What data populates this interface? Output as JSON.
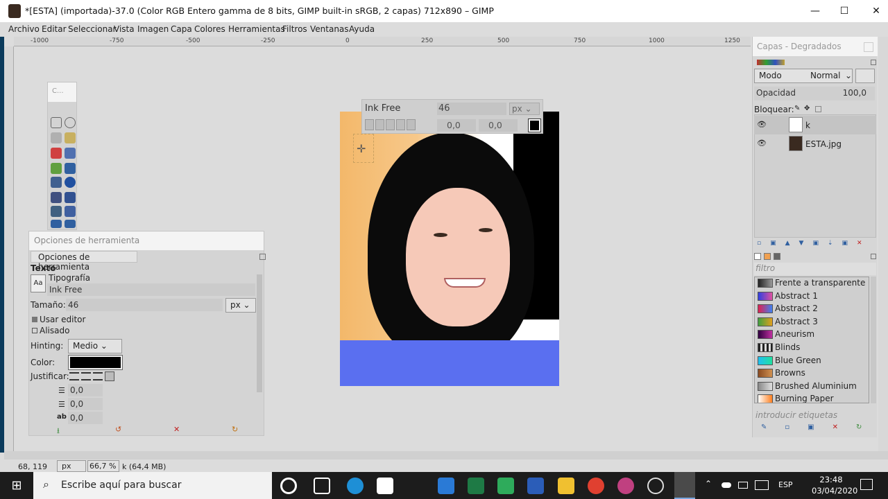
{
  "window": {
    "title": "*[ESTA] (importada)-37.0 (Color RGB Entero gamma de 8 bits, GIMP built-in sRGB, 2 capas) 712x890 – GIMP",
    "minimize": "—",
    "maximize": "☐",
    "close": "✕"
  },
  "menu": [
    "Archivo",
    "Editar",
    "Seleccionar",
    "Vista",
    "Imagen",
    "Capa",
    "Colores",
    "Herramientas",
    "Filtros",
    "Ventanas",
    "Ayuda"
  ],
  "ruler": [
    "-1000",
    "-750",
    "-500",
    "-250",
    "0",
    "250",
    "500",
    "750",
    "1000",
    "1250"
  ],
  "textbar": {
    "font": "Ink Free",
    "size": "46",
    "unit": "px",
    "baseline": "0,0",
    "kerning": "0,0"
  },
  "toolbox": {
    "title": "C..."
  },
  "tool_options": {
    "title": "Opciones de herramienta",
    "tab": "Opciones de herramienta",
    "section": "Texto",
    "font_label": "Tipografía",
    "font_value": "Ink Free",
    "size_label": "Tamaño:",
    "size_value": "46",
    "size_unit": "px",
    "use_editor": "Usar editor",
    "antialias": "Alisado",
    "hinting_label": "Hinting:",
    "hinting_value": "Medio",
    "color_label": "Color:",
    "color_value": "#000000",
    "justify_label": "Justificar:",
    "indent": "0,0",
    "line_spacing": "0,0",
    "letter_spacing": "0,0"
  },
  "layers_panel": {
    "title": "Capas - Degradados",
    "mode_label": "Modo",
    "mode_value": "Normal",
    "opacity_label": "Opacidad",
    "opacity_value": "100,0",
    "lock_label": "Bloquear:",
    "layers": [
      {
        "name": "k",
        "active": true
      },
      {
        "name": "ESTA.jpg",
        "active": false
      }
    ]
  },
  "gradients_panel": {
    "filter_placeholder": "filtro",
    "tags_placeholder": "introducir etiquetas",
    "items": [
      {
        "name": "Frente a transparente",
        "c1": "#222222",
        "c2": "#999999"
      },
      {
        "name": "Abstract 1",
        "c1": "#3040e0",
        "c2": "#e050a0"
      },
      {
        "name": "Abstract 2",
        "c1": "#e02050",
        "c2": "#4080f0"
      },
      {
        "name": "Abstract 3",
        "c1": "#40a040",
        "c2": "#e0a020"
      },
      {
        "name": "Aneurism",
        "c1": "#300040",
        "c2": "#c030a0"
      },
      {
        "name": "Blinds",
        "c1": "#222222",
        "c2": "#dddddd"
      },
      {
        "name": "Blue Green",
        "c1": "#20c0f0",
        "c2": "#20e0a0"
      },
      {
        "name": "Browns",
        "c1": "#8a4a20",
        "c2": "#d09050"
      },
      {
        "name": "Brushed Aluminium",
        "c1": "#888888",
        "c2": "#e0e0e0"
      },
      {
        "name": "Burning Paper",
        "c1": "#ffffff",
        "c2": "#ff8020"
      }
    ]
  },
  "status": {
    "coords": "68, 119",
    "unit": "px",
    "zoom": "66,7 %",
    "layer_info": "k (64,4 MB)"
  },
  "taskbar": {
    "search_placeholder": "Escribe aquí para buscar",
    "language": "ESP",
    "time": "23:48",
    "date": "03/04/2020"
  }
}
